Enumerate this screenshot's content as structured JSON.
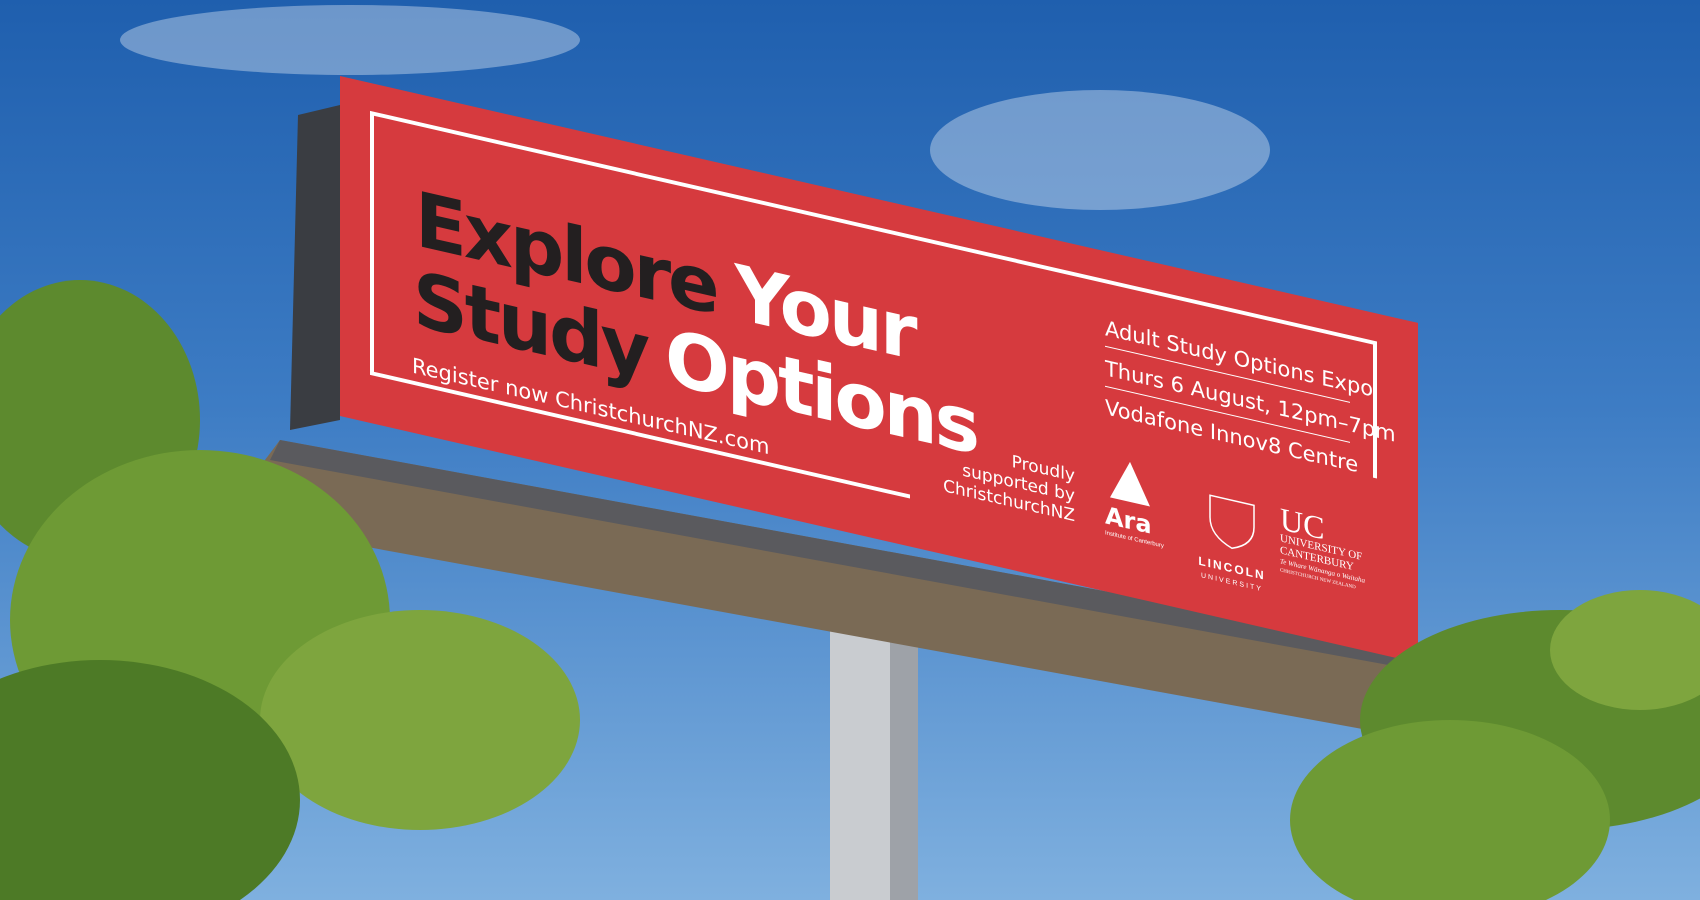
{
  "billboard": {
    "headline_dark_1": "Explore",
    "headline_light_1": "Your",
    "headline_dark_2": "Study",
    "headline_light_2": "Options",
    "register": "Register now ChristchurchNZ.com",
    "event_lines": [
      "Adult Study Options Expo",
      "Thurs 6 August, 12pm–7pm",
      "Vodafone Innov8 Centre"
    ],
    "supported": [
      "Proudly",
      "supported by",
      "ChristchurchNZ"
    ],
    "logos": {
      "ara": {
        "name": "Ara",
        "sub": "Institute of Canterbury"
      },
      "lincoln": {
        "name": "LINCOLN",
        "sub": "UNIVERSITY"
      },
      "uc": {
        "name": "UC",
        "line1": "UNIVERSITY OF",
        "line2": "CANTERBURY",
        "line3": "Te Whare Wānanga o Waitaha",
        "line4": "CHRISTCHURCH NEW ZEALAND"
      }
    },
    "colors": {
      "board": "#d63a3e",
      "dark_text": "#231f20",
      "light_text": "#ffffff"
    }
  }
}
